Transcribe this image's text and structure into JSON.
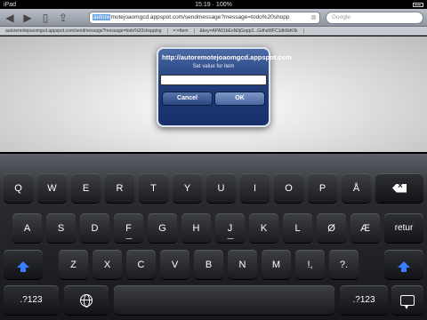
{
  "status": {
    "carrier": "iPad",
    "time": "15:19",
    "battery": "100%"
  },
  "browser": {
    "url_highlight": "autore",
    "url_rest": "motejoaomgcd.appspot.com/sendmessage?message=todo%20shopp",
    "search_placeholder": "Google",
    "bookmarks": [
      "autoremotejoaomgcd.appspot.com/sendmessage?message=todo%20shopping",
      "=:=Item",
      "&key=APA91bEoN0jGopp3...GdhsWFC1dk6kK0k"
    ]
  },
  "alert": {
    "title": "http://autoremotejoaomgcd.appspot.com",
    "message": "Set value for item",
    "input_value": "",
    "cancel_label": "Cancel",
    "ok_label": "OK"
  },
  "keyboard": {
    "row1": [
      "Q",
      "W",
      "E",
      "R",
      "T",
      "Y",
      "U",
      "I",
      "O",
      "P",
      "Å"
    ],
    "row2": [
      "A",
      "S",
      "D",
      "F",
      "G",
      "H",
      "J",
      "K",
      "L",
      "Ø",
      "Æ"
    ],
    "row3": [
      "Z",
      "X",
      "C",
      "V",
      "B",
      "N",
      "M",
      "!,",
      "?."
    ],
    "return_label": "retur",
    "numbers_label": ".?123",
    "icons": [
      "backspace-icon",
      "shift-icon",
      "globe-icon",
      "keyboard-dismiss-icon"
    ]
  },
  "colors": {
    "alert_blue": "#223e7a",
    "shift_blue": "#3b7cff",
    "url_highlight": "#6ea6e8"
  }
}
